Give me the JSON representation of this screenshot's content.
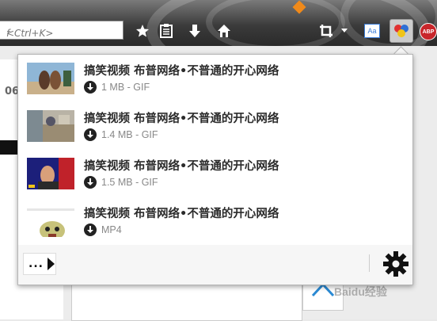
{
  "toolbar": {
    "search_placeholder": "<Ctrl+K>",
    "search_partial": "f",
    "icons": [
      "star-icon",
      "reading-list-icon",
      "download-icon",
      "home-icon",
      "crop-icon",
      "dropdown-icon",
      "translate-icon",
      "video-downloader-icon",
      "adblock-icon"
    ],
    "translate_label": "Aa",
    "abp_label": "ABP"
  },
  "page": {
    "partial_text": "06",
    "watermark": "Baidu经验"
  },
  "downloads": {
    "items": [
      {
        "title": "搞笑视频 布普网络•不普通的开心网络",
        "size": "1 MB - GIF"
      },
      {
        "title": "搞笑视频 布普网络•不普通的开心网络",
        "size": "1.4 MB - GIF"
      },
      {
        "title": "搞笑视频 布普网络•不普通的开心网络",
        "size": "1.5 MB - GIF"
      },
      {
        "title": "搞笑视频 布普网络•不普通的开心网络",
        "size": "MP4"
      }
    ],
    "more_label": "..."
  },
  "colors": {
    "toolbar_dark": "#2a2a2a",
    "panel_bg": "#f6f6f6",
    "abp_red": "#c8262b"
  }
}
